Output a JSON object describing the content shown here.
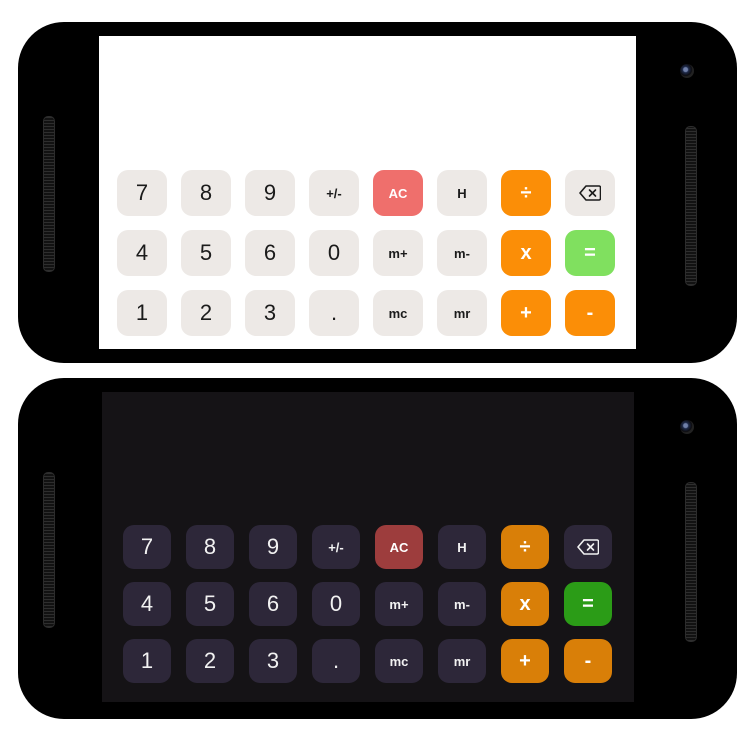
{
  "colors": {
    "light_key": "#ede9e6",
    "light_ac": "#ef6f6c",
    "light_operator": "#fb8e07",
    "light_equals": "#80e05f",
    "dark_screen": "#151316",
    "dark_key": "#2d2739",
    "dark_ac": "#9d3d3d",
    "dark_operator": "#d97f08",
    "dark_equals": "#2b9c17"
  },
  "light": {
    "display": "",
    "keys": {
      "k7": "7",
      "k8": "8",
      "k9": "9",
      "plusminus": "+/-",
      "ac": "AC",
      "history": "H",
      "divide": "÷",
      "backspace_icon": "backspace-icon",
      "k4": "4",
      "k5": "5",
      "k6": "6",
      "k0": "0",
      "mplus": "m+",
      "mminus": "m-",
      "multiply": "x",
      "equals": "=",
      "k1": "1",
      "k2": "2",
      "k3": "3",
      "dot": ".",
      "mc": "mc",
      "mr": "mr",
      "plus": "+",
      "minus": "-"
    }
  },
  "dark": {
    "display": "",
    "keys": {
      "k7": "7",
      "k8": "8",
      "k9": "9",
      "plusminus": "+/-",
      "ac": "AC",
      "history": "H",
      "divide": "÷",
      "backspace_icon": "backspace-icon",
      "k4": "4",
      "k5": "5",
      "k6": "6",
      "k0": "0",
      "mplus": "m+",
      "mminus": "m-",
      "multiply": "x",
      "equals": "=",
      "k1": "1",
      "k2": "2",
      "k3": "3",
      "dot": ".",
      "mc": "mc",
      "mr": "mr",
      "plus": "+",
      "minus": "-"
    }
  }
}
